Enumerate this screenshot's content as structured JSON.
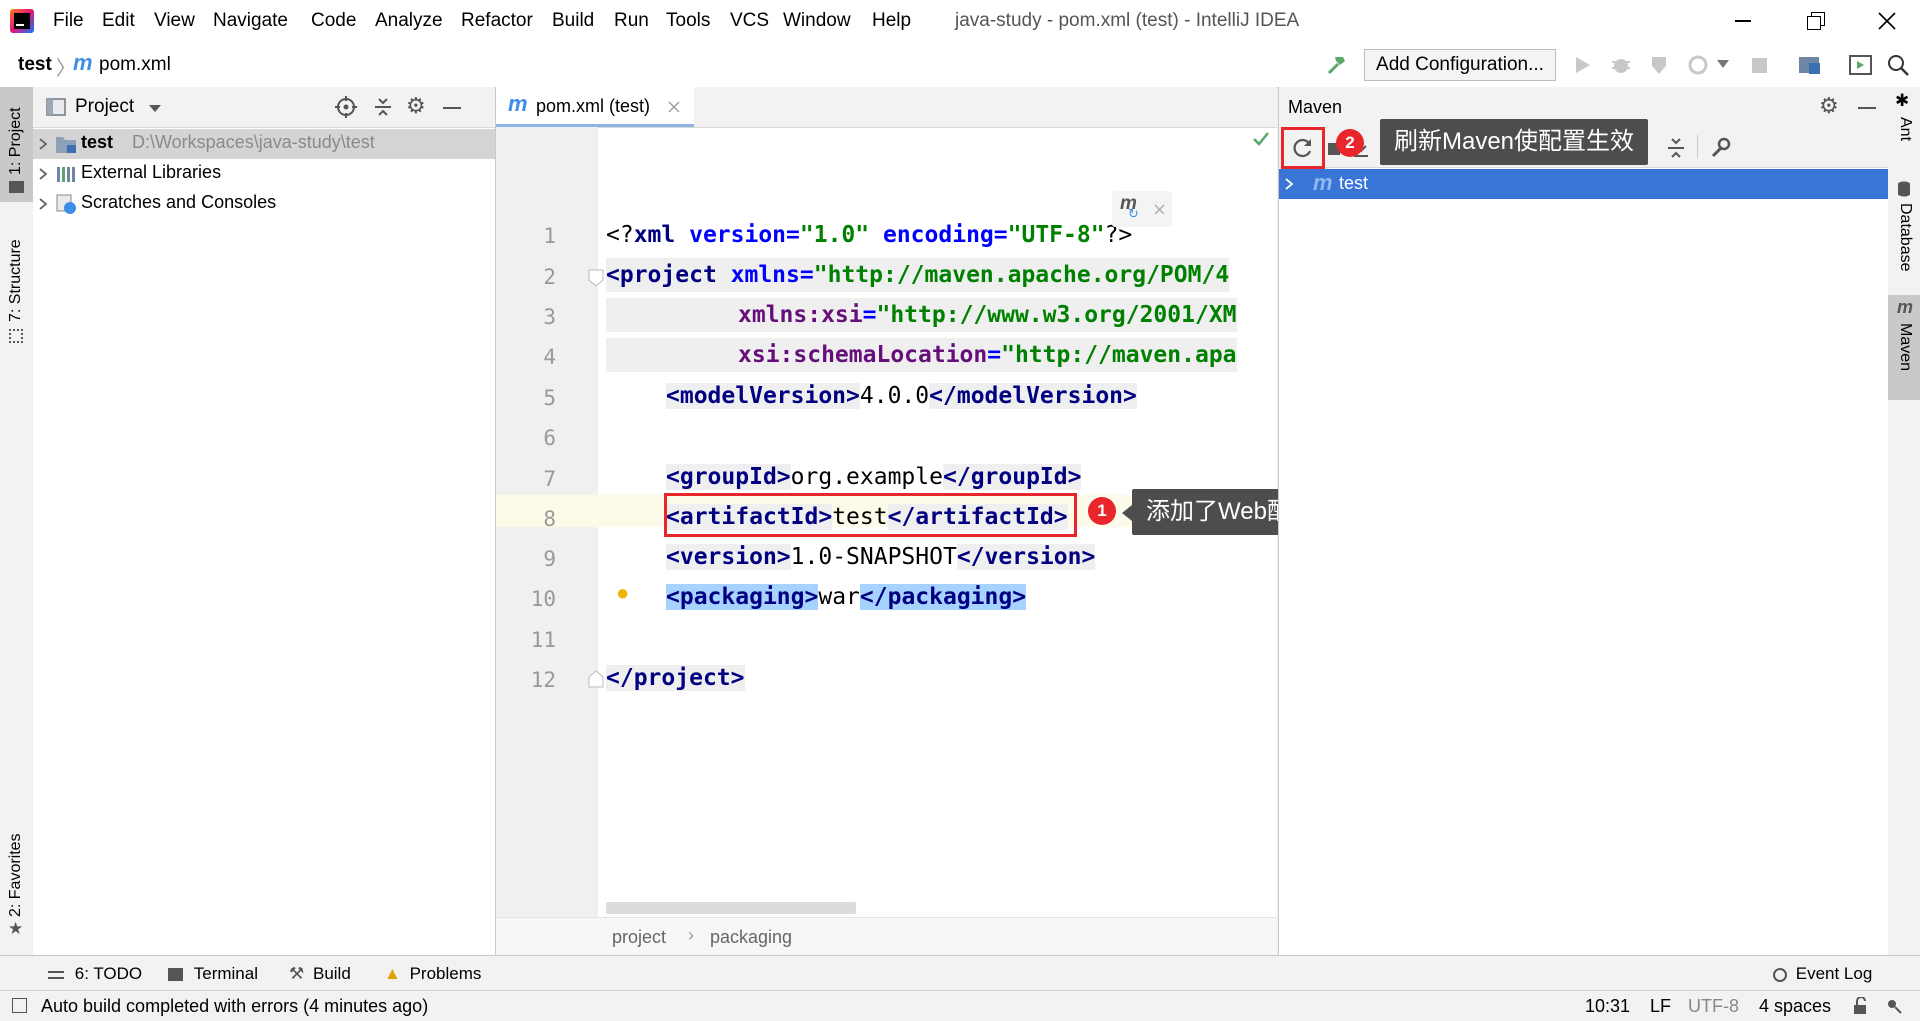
{
  "window": {
    "title": "java-study - pom.xml (test) - IntelliJ IDEA",
    "menu": [
      "File",
      "Edit",
      "View",
      "Navigate",
      "Code",
      "Analyze",
      "Refactor",
      "Build",
      "Run",
      "Tools",
      "VCS",
      "Window",
      "Help"
    ]
  },
  "navbar": {
    "breadcrumb_project": "test",
    "breadcrumb_file": "pom.xml",
    "run_config": "Add Configuration..."
  },
  "left_stripe": {
    "project": "1: Project",
    "structure": "7: Structure",
    "favorites": "2: Favorites"
  },
  "project_panel": {
    "title": "Project",
    "items": [
      {
        "name": "test",
        "path": "D:\\Workspaces\\java-study\\test"
      },
      {
        "name": "External Libraries"
      },
      {
        "name": "Scratches and Consoles"
      }
    ]
  },
  "editor": {
    "tab": "pom.xml (test)",
    "line_numbers": [
      "1",
      "2",
      "3",
      "4",
      "5",
      "6",
      "7",
      "8",
      "9",
      "10",
      "11",
      "12"
    ],
    "breadcrumbs": [
      "project",
      "packaging"
    ],
    "code": {
      "l1_open": "<?",
      "l1_xml": "xml",
      "l1_version_attr": " version",
      "l1_eq": "=",
      "l1_version_val": "\"1.0\"",
      "l1_enc_attr": " encoding",
      "l1_enc_val": "\"UTF-8\"",
      "l1_close": "?>",
      "l2_open": "<",
      "l2_tag": "project",
      "l2_attr": " xmlns",
      "l2_val": "\"http://maven.apache.org/POM/4",
      "l3_attr": "xmlns:xsi",
      "l3_val": "\"http://www.w3.org/2001/XM",
      "l4_attr": "xsi:schemaLocation",
      "l4_val": "\"http://maven.apa",
      "l5_tag": "modelVersion",
      "l5_text": "4.0.0",
      "l7_tag": "groupId",
      "l7_text": "org.example",
      "l8_tag": "artifactId",
      "l8_text": "test",
      "l9_tag": "version",
      "l9_text": "1.0-SNAPSHOT",
      "l10_tag": "packaging",
      "l10_text": "war",
      "l12_tag": "project"
    }
  },
  "maven_panel": {
    "title": "Maven",
    "tree_item": "test"
  },
  "right_stripe": {
    "ant": "Ant",
    "database": "Database",
    "maven": "Maven"
  },
  "annotations": {
    "callout1_num": "1",
    "callout1_text": "添加了Web配置",
    "callout2_num": "2",
    "callout2_text": "刷新Maven使配置生效"
  },
  "bottom_tools": {
    "todo": "6: TODO",
    "terminal": "Terminal",
    "build": "Build",
    "problems": "Problems",
    "event_log": "Event Log"
  },
  "status": {
    "message": "Auto build completed with errors (4 minutes ago)",
    "position": "10:31",
    "line_sep": "LF",
    "encoding": "UTF-8",
    "indent": "4 spaces"
  },
  "colors": {
    "accent_red": "#e8262b",
    "selection_blue": "#3875d7",
    "tag_navy": "#000080",
    "string_green": "#008000"
  }
}
